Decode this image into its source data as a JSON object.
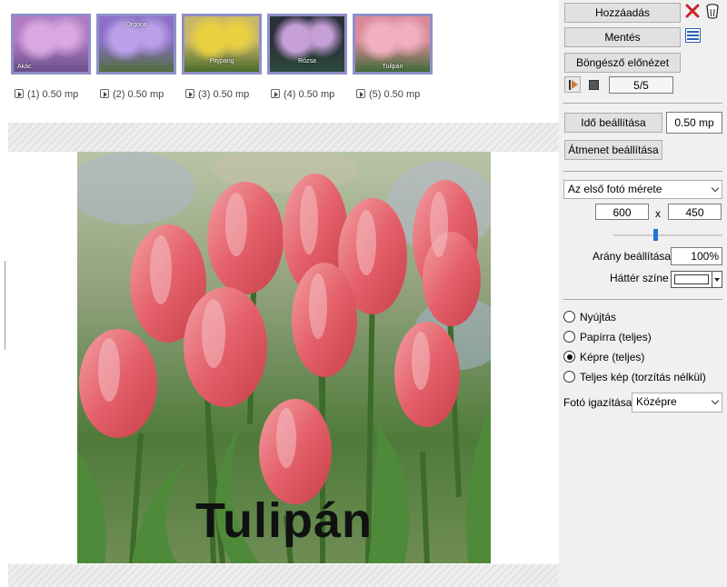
{
  "thumbnails": [
    {
      "caption": "Akác",
      "label": "(1) 0.50 mp",
      "colors": [
        "#b07bc4",
        "#6a4f8a",
        "#d9a8e0"
      ]
    },
    {
      "caption": "Orgona",
      "label": "(2) 0.50 mp",
      "colors": [
        "#8b6fc8",
        "#4f6d3a",
        "#bba0e8"
      ]
    },
    {
      "caption": "Pitypang",
      "label": "(3) 0.50 mp",
      "colors": [
        "#c8b66a",
        "#4a6b2a",
        "#e8d040"
      ]
    },
    {
      "caption": "Rózsa",
      "label": "(4) 0.50 mp",
      "colors": [
        "#2b2f3a",
        "#2c4a3a",
        "#c7a0d8"
      ]
    },
    {
      "caption": "Tulipán",
      "label": "(5) 0.50 mp",
      "colors": [
        "#d98a9a",
        "#3f6b35",
        "#f0b0c0"
      ]
    }
  ],
  "preview": {
    "caption": "Tulipán"
  },
  "panel": {
    "add_label": "Hozzáadás",
    "save_label": "Mentés",
    "browser_preview_label": "Böngésző előnézet",
    "counter": "5/5",
    "time_button": "Idő beállítása",
    "time_value": "0.50 mp",
    "transition_button": "Átmenet beállítása",
    "size_select": "Az első fotó mérete",
    "width": "600",
    "x_sep": "x",
    "height": "450",
    "ratio_label": "Arány beállítása",
    "ratio_value": "100%",
    "bg_label": "Háttér színe",
    "bg_color": "#ffffff",
    "options": [
      {
        "label": "Nyújtás",
        "selected": false
      },
      {
        "label": "Papírra (teljes)",
        "selected": false
      },
      {
        "label": "Képre (teljes)",
        "selected": true
      },
      {
        "label": "Teljes kép (torzítás nélkül)",
        "selected": false
      }
    ],
    "align_label": "Fotó igazítása",
    "align_value": "Középre"
  }
}
